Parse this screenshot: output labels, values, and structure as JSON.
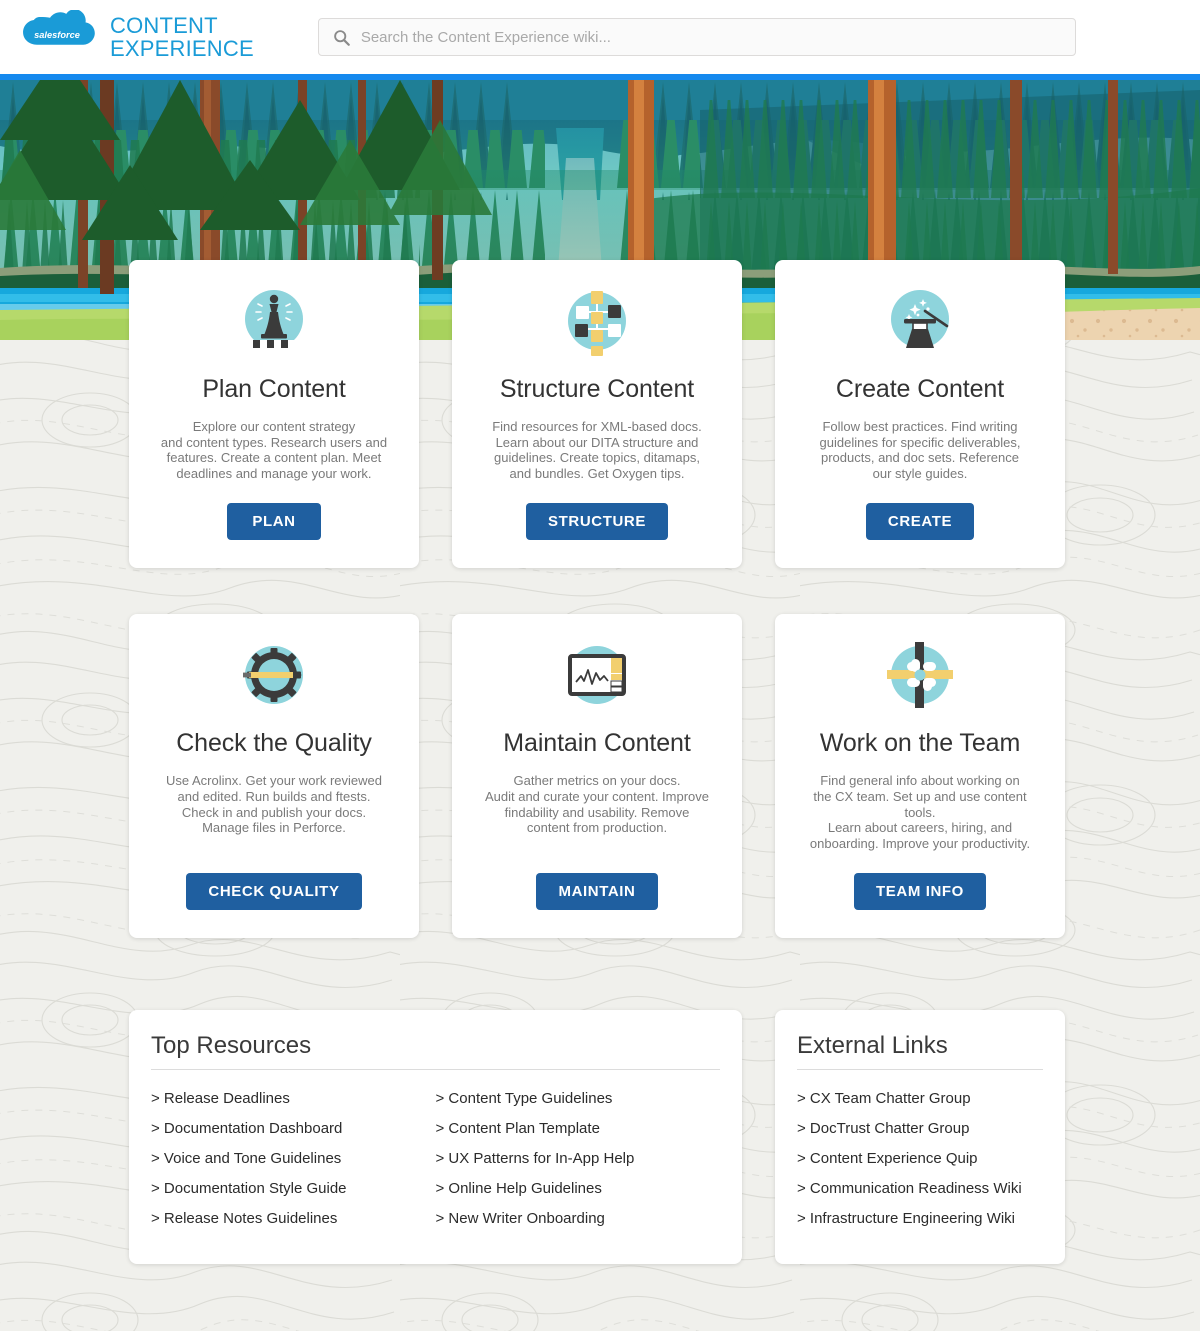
{
  "brand": {
    "logo_icon": "salesforce-cloud-logo",
    "logo_text": "salesforce",
    "title": "CONTENT\nEXPERIENCE"
  },
  "search": {
    "icon": "search-icon",
    "placeholder": "Search the Content Experience wiki...",
    "value": ""
  },
  "hero": {
    "illustration": "forest-waterfall-lake-landscape"
  },
  "colors": {
    "brand_blue": "#1a9bd7",
    "divider_blue": "#1589ee",
    "button_blue": "#1f5fa0",
    "icon_circle": "#8ed4dc",
    "page_bg": "#f0f0ec"
  },
  "cards": [
    {
      "icon": "chess-queen-icon",
      "title": "Plan Content",
      "desc": "Explore our content strategy\nand content types. Research users and\nfeatures. Create a content plan. Meet\ndeadlines and manage your work.",
      "button": "PLAN"
    },
    {
      "icon": "hierarchy-tree-icon",
      "title": "Structure Content",
      "desc": "Find resources for XML-based docs.\nLearn about our DITA structure and\nguidelines. Create topics, ditamaps,\nand bundles. Get Oxygen tips.",
      "button": "STRUCTURE"
    },
    {
      "icon": "magic-hat-wand-icon",
      "title": "Create Content",
      "desc": "Follow best practices. Find writing\nguidelines for specific deliverables,\nproducts, and doc sets. Reference\nour style guides.",
      "button": "CREATE"
    },
    {
      "icon": "gear-pencil-icon",
      "title": "Check the Quality",
      "desc": "Use Acrolinx. Get your work reviewed\nand edited. Run builds and ftests.\nCheck in and publish your docs.\nManage files in Perforce.",
      "button": "CHECK QUALITY"
    },
    {
      "icon": "monitor-chart-icon",
      "title": "Maintain Content",
      "desc": "Gather metrics on your docs.\nAudit and curate your content. Improve\nfindability and usability. Remove\ncontent from production.",
      "button": "MAINTAIN"
    },
    {
      "icon": "teamwork-pinwheel-icon",
      "title": "Work on the Team",
      "desc": "Find general info about working on\nthe CX team. Set up and use content tools.\nLearn about careers, hiring, and\nonboarding. Improve your productivity.",
      "button": "TEAM INFO"
    }
  ],
  "top_resources": {
    "title": "Top Resources",
    "column_left": [
      "> Release Deadlines",
      "> Documentation Dashboard",
      "> Voice and Tone Guidelines",
      "> Documentation Style Guide",
      "> Release Notes Guidelines"
    ],
    "column_right": [
      "> Content Type Guidelines",
      "> Content Plan Template",
      "> UX Patterns for In-App Help",
      "> Online Help Guidelines",
      "> New Writer Onboarding"
    ]
  },
  "external_links": {
    "title": "External Links",
    "items": [
      "> CX Team Chatter Group",
      "> DocTrust Chatter Group",
      "> Content Experience Quip",
      "> Communication Readiness Wiki",
      "> Infrastructure Engineering Wiki"
    ]
  }
}
